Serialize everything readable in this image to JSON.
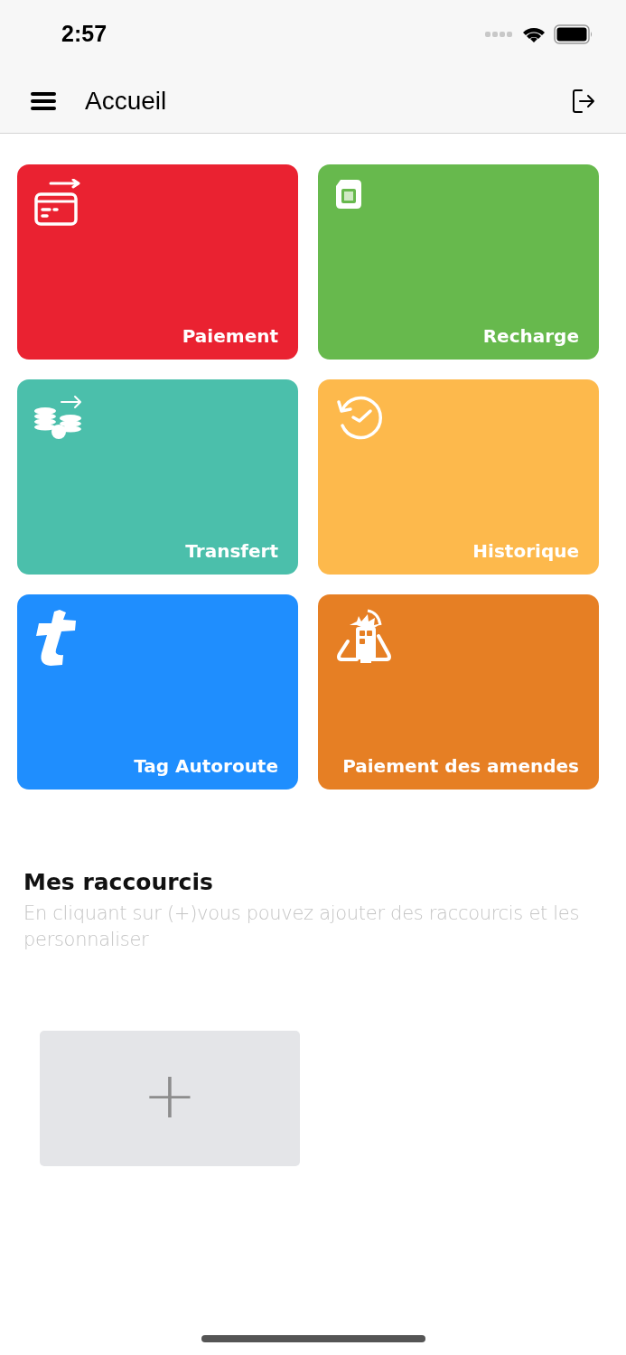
{
  "status_bar": {
    "time": "2:57"
  },
  "nav_bar": {
    "title": "Accueil"
  },
  "tiles": [
    {
      "label": "Paiement",
      "kind": "card",
      "color": "#ea2231"
    },
    {
      "label": "Recharge",
      "kind": "sim",
      "color": "#67b94d"
    },
    {
      "label": "Transfert",
      "kind": "coins",
      "color": "#4bbfab"
    },
    {
      "label": "Historique",
      "kind": "history",
      "color": "#fdb94c"
    },
    {
      "label": "Tag Autoroute",
      "kind": "tag",
      "color": "#1f8efe"
    },
    {
      "label": "Paiement des amendes",
      "kind": "fine",
      "color": "#e67f24"
    }
  ],
  "shortcuts": {
    "title": "Mes raccourcis",
    "description": "En cliquant sur (+)vous pouvez ajouter des raccourcis et les personnaliser",
    "add_label": "+"
  }
}
